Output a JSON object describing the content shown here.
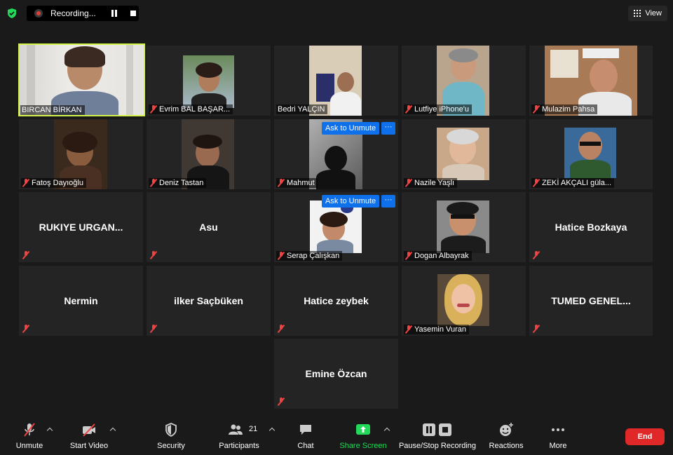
{
  "recording": {
    "label": "Recording..."
  },
  "view": {
    "label": "View"
  },
  "participants_tiles": [
    {
      "name": "BIRCAN BİRKAN"
    },
    {
      "name": "Evrim BAL BAŞAR..."
    },
    {
      "name": "Bedri YALÇIN"
    },
    {
      "name": "Lutfiye iPhone'u"
    },
    {
      "name": "Mulazim Pahsa"
    },
    {
      "name": "Fatoş Dayıoğlu"
    },
    {
      "name": "Deniz Tastan"
    },
    {
      "name": "Mahmut"
    },
    {
      "name": "Nazile Yaşlı"
    },
    {
      "name": "ZEKİ AKÇALI güla..."
    },
    {
      "name": "RUKIYE URGAN..."
    },
    {
      "name": "Asu"
    },
    {
      "name": "Serap Çalışkan"
    },
    {
      "name": "Dogan Albayrak"
    },
    {
      "name": "Hatice Bozkaya"
    },
    {
      "name": "Nermin"
    },
    {
      "name": "ilker Saçbüken"
    },
    {
      "name": "Hatice zeybek"
    },
    {
      "name": "Yasemin Vuran"
    },
    {
      "name": "TUMED GENEL..."
    },
    {
      "name": "Emine Özcan"
    }
  ],
  "chips": {
    "ask_to_unmute": "Ask to Unmute",
    "more": "···"
  },
  "toolbar": {
    "unmute": "Unmute",
    "start_video": "Start Video",
    "security": "Security",
    "participants": "Participants",
    "participants_count": "21",
    "chat": "Chat",
    "share_screen": "Share Screen",
    "pause_stop_recording": "Pause/Stop Recording",
    "reactions": "Reactions",
    "more": "More",
    "end": "End"
  },
  "colors": {
    "active_speaker": "#d3f24a",
    "share_green": "#23d959",
    "end_red": "#e02828",
    "chip_blue": "#0e71eb"
  }
}
